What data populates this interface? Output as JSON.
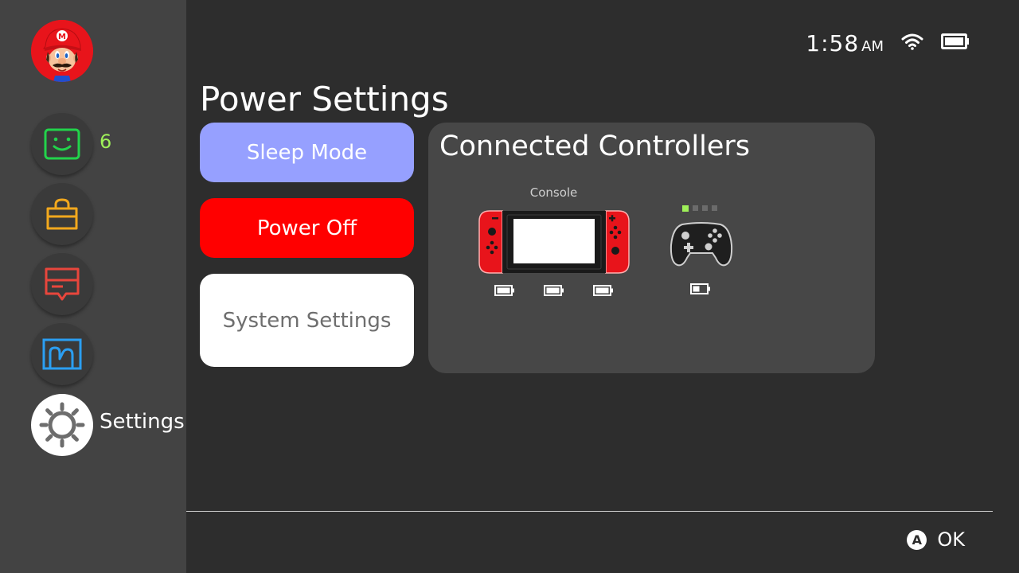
{
  "status": {
    "time": "1:58",
    "ampm": "AM",
    "wifi_icon": "wifi-icon",
    "battery_icon": "battery-full-icon"
  },
  "sidebar": {
    "avatar": "user-avatar",
    "items": [
      {
        "icon": "smiley-icon",
        "color": "#22d34b",
        "badge": "6"
      },
      {
        "icon": "shopping-bag-icon",
        "color": "#f2a81d"
      },
      {
        "icon": "news-message-icon",
        "color": "#e8463c"
      },
      {
        "icon": "album-icon",
        "color": "#2b9ff2"
      },
      {
        "icon": "gear-icon",
        "color": "#6d6d6d",
        "label": "Settings",
        "selected": true
      }
    ]
  },
  "page": {
    "title": "Power Settings"
  },
  "menu": {
    "sleep_label": "Sleep Mode",
    "power_off_label": "Power Off",
    "system_settings_label": "System Settings",
    "colors": {
      "sleep": "#96a0ff",
      "power_off": "#ff0000",
      "system_settings": "#ffffff"
    }
  },
  "controllers": {
    "title": "Connected Controllers",
    "console_label": "Console",
    "console_color": "#e8141b",
    "player_led_color": "#9ff059"
  },
  "footer": {
    "button_glyph": "A",
    "ok_label": "OK"
  }
}
